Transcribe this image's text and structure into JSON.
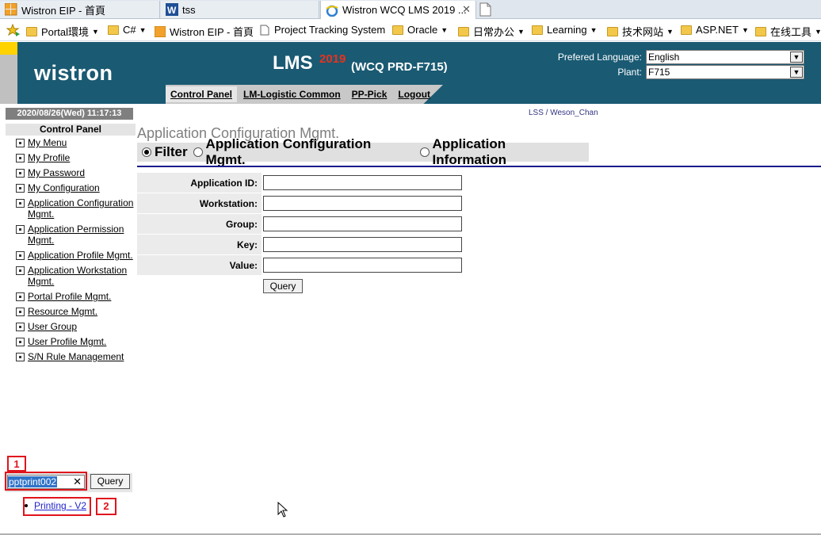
{
  "browser": {
    "tabs": [
      {
        "label": "Wistron EIP - 首頁",
        "icon": "portal-icon"
      },
      {
        "label": "tss",
        "icon": "word-icon"
      },
      {
        "label": "Wistron WCQ LMS 2019 ...",
        "icon": "ie-icon",
        "active": true
      }
    ],
    "favorites": [
      {
        "label": "Portal環境",
        "dropdown": true
      },
      {
        "label": "C#",
        "dropdown": true
      },
      {
        "label": "Wistron EIP - 首頁",
        "dropdown": false
      },
      {
        "label": "Project Tracking System",
        "dropdown": false
      },
      {
        "label": "Oracle",
        "dropdown": true
      },
      {
        "label": "日常办公",
        "dropdown": true
      },
      {
        "label": "Learning",
        "dropdown": true
      },
      {
        "label": "技术网站",
        "dropdown": true
      },
      {
        "label": "ASP.NET",
        "dropdown": true
      },
      {
        "label": "在线工具",
        "dropdown": true
      }
    ]
  },
  "header": {
    "logo": "wistron",
    "app": "LMS",
    "year": "2019",
    "site": "(WCQ PRD-F715)",
    "lang_label": "Prefered Language:",
    "lang_value": "English",
    "plant_label": "Plant:",
    "plant_value": "F715"
  },
  "nav": [
    "Control Panel",
    "LM-Logistic Common",
    "PP-Pick",
    "Logout"
  ],
  "datetime": "2020/08/26(Wed) 11:17:13",
  "user": "LSS / Weson_Chan",
  "sidebar": {
    "title": "Control Panel",
    "items": [
      "My Menu",
      "My Profile",
      "My Password",
      "My Configuration",
      "Application Configuration Mgmt.",
      "Application Permission Mgmt.",
      "Application Profile Mgmt.",
      "Application Workstation Mgmt.",
      "Portal Profile Mgmt.",
      "Resource Mgmt.",
      "User Group",
      "User Profile Mgmt.",
      "S/N Rule Management"
    ]
  },
  "main": {
    "title": "Application Configuration Mgmt.",
    "radios": [
      "Filter",
      "Application Configuration Mgmt.",
      "Application Information"
    ],
    "selected_radio": "Filter",
    "fields": [
      {
        "label": "Application ID:",
        "value": ""
      },
      {
        "label": "Workstation:",
        "value": ""
      },
      {
        "label": "Group:",
        "value": ""
      },
      {
        "label": "Key:",
        "value": ""
      },
      {
        "label": "Value:",
        "value": ""
      }
    ],
    "query_label": "Query"
  },
  "search": {
    "value": "pptprint002",
    "button": "Query",
    "marker1": "1",
    "marker2": "2",
    "result": "Printing - V2"
  },
  "colors": {
    "header_bg": "#1a5a73",
    "accent_red": "#e0141c",
    "link_blue": "#2222cc"
  }
}
